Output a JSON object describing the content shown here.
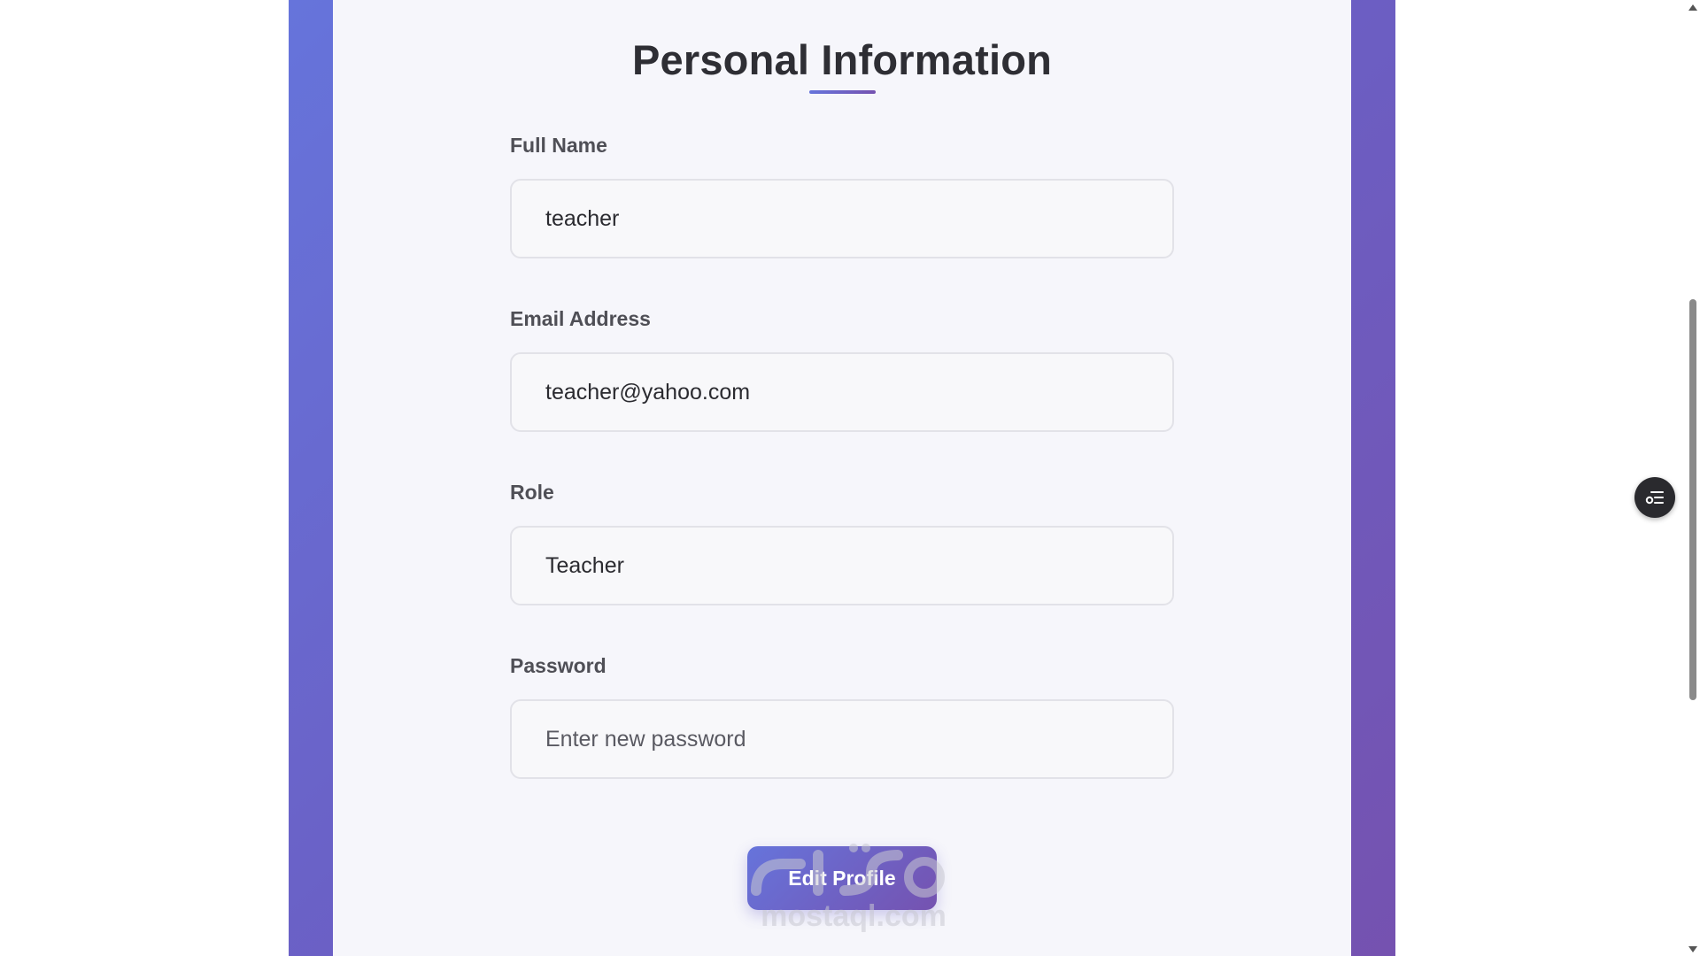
{
  "profile_form": {
    "title": "Personal Information",
    "full_name": {
      "label": "Full Name",
      "value": "teacher"
    },
    "email": {
      "label": "Email Address",
      "value": "teacher@yahoo.com"
    },
    "role": {
      "label": "Role",
      "value": "Teacher"
    },
    "password": {
      "label": "Password",
      "value": "",
      "placeholder": "Enter new password"
    },
    "edit_button_label": "Edit Profile"
  },
  "watermark": {
    "text": "mostaql.com"
  },
  "floating_button": {
    "icon": "list-settings-icon"
  },
  "theme": {
    "gradient_start": "#6674db",
    "gradient_end": "#7552b0",
    "card_background": "#f6f6fb",
    "title_color": "#2e2e34",
    "label_color": "#4f4f56"
  }
}
